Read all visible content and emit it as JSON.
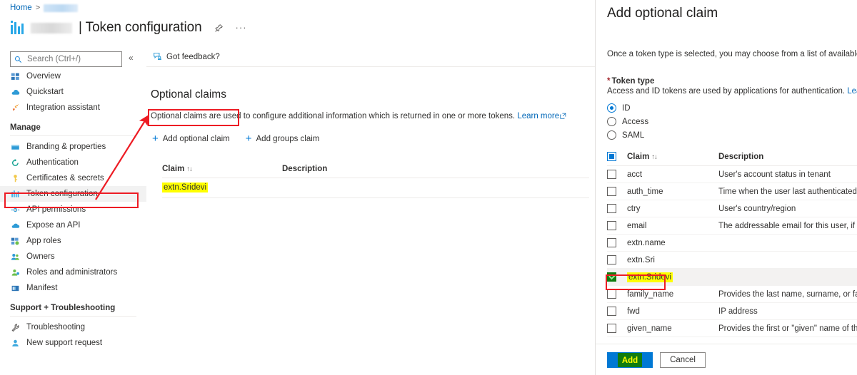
{
  "breadcrumb": {
    "home": "Home",
    "separator": ">",
    "redacted": true
  },
  "header": {
    "app_name_redacted": true,
    "title": "| Token configuration",
    "pin_icon": "pin-icon",
    "more_icon": "ellipsis-icon"
  },
  "search": {
    "placeholder": "Search (Ctrl+/)",
    "value": "",
    "icon": "search-icon",
    "collapse_icon": "chevron-double-left-icon"
  },
  "sidebar": {
    "items": [
      {
        "label": "Overview",
        "icon": "overview-icon",
        "selected": false
      },
      {
        "label": "Quickstart",
        "icon": "quickstart-icon",
        "selected": false
      },
      {
        "label": "Integration assistant",
        "icon": "rocket-icon",
        "selected": false
      }
    ],
    "group_manage": "Manage",
    "manage_items": [
      {
        "label": "Branding & properties",
        "icon": "branding-icon",
        "selected": false
      },
      {
        "label": "Authentication",
        "icon": "authentication-icon",
        "selected": false
      },
      {
        "label": "Certificates & secrets",
        "icon": "key-icon",
        "selected": false
      },
      {
        "label": "Token configuration",
        "icon": "token-configuration-icon",
        "selected": true
      },
      {
        "label": "API permissions",
        "icon": "api-permissions-icon",
        "selected": false
      },
      {
        "label": "Expose an API",
        "icon": "cloud-icon",
        "selected": false
      },
      {
        "label": "App roles",
        "icon": "app-roles-icon",
        "selected": false
      },
      {
        "label": "Owners",
        "icon": "owners-icon",
        "selected": false
      },
      {
        "label": "Roles and administrators",
        "icon": "roles-admins-icon",
        "selected": false
      },
      {
        "label": "Manifest",
        "icon": "manifest-icon",
        "selected": false
      }
    ],
    "group_support": "Support + Troubleshooting",
    "support_items": [
      {
        "label": "Troubleshooting",
        "icon": "wrench-icon",
        "selected": false
      },
      {
        "label": "New support request",
        "icon": "support-person-icon",
        "selected": false
      }
    ]
  },
  "content": {
    "feedback_label": "Got feedback?",
    "feedback_icon": "feedback-icon",
    "section_title": "Optional claims",
    "section_desc": "Optional claims are used to configure additional information which is returned in one or more tokens.",
    "learn_more": "Learn more",
    "commands": [
      {
        "label": "Add optional claim",
        "icon": "plus-icon",
        "annotated": true
      },
      {
        "label": "Add groups claim",
        "icon": "plus-icon",
        "annotated": false
      }
    ],
    "table": {
      "columns": [
        "Claim",
        "Description"
      ],
      "sort_indicator": "↑↓",
      "rows": [
        {
          "claim": "extn.Sridevi",
          "description": "",
          "highlighted": true
        }
      ]
    }
  },
  "panel": {
    "title": "Add optional claim",
    "description": "Once a token type is selected, you may choose from a list of available optional clain",
    "token_type_label": "Token type",
    "token_type_required": "*",
    "token_type_sub": "Access and ID tokens are used by applications for authentication.",
    "learn_more": "Learn more",
    "token_types": [
      {
        "label": "ID",
        "selected": true
      },
      {
        "label": "Access",
        "selected": false
      },
      {
        "label": "SAML",
        "selected": false
      }
    ],
    "table": {
      "columns": [
        "Claim",
        "Description"
      ],
      "sort_indicator": "↑↓",
      "header_checkbox_state": "partial",
      "rows": [
        {
          "claim": "acct",
          "description": "User's account status in tenant",
          "checked": false
        },
        {
          "claim": "auth_time",
          "description": "Time when the user last authenticated; See Op",
          "checked": false
        },
        {
          "claim": "ctry",
          "description": "User's country/region",
          "checked": false
        },
        {
          "claim": "email",
          "description": "The addressable email for this user, if the user",
          "checked": false
        },
        {
          "claim": "extn.name",
          "description": "",
          "checked": false
        },
        {
          "claim": "extn.Sri",
          "description": "",
          "checked": false
        },
        {
          "claim": "extn.Sridevi",
          "description": "",
          "checked": true,
          "highlighted": true
        },
        {
          "claim": "family_name",
          "description": "Provides the last name, surname, or family na",
          "checked": false
        },
        {
          "claim": "fwd",
          "description": "IP address",
          "checked": false
        },
        {
          "claim": "given_name",
          "description": "Provides the first or \"given\" name of the user,",
          "checked": false
        }
      ]
    },
    "add_button": "Add",
    "cancel_button": "Cancel"
  },
  "annotations": {
    "arrow_color": "#ed1c24",
    "rect_color": "#ed1c24",
    "highlight_color": "#ffff00",
    "check_color": "#107c10"
  },
  "colors": {
    "accent": "#0078d4",
    "link": "#0067b8",
    "selected_bg": "#f2f2f2",
    "required": "#a4262c"
  }
}
